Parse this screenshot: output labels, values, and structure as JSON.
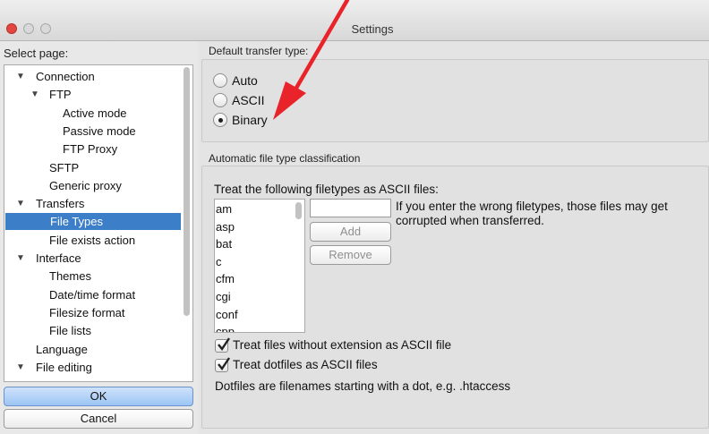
{
  "window": {
    "title": "Settings"
  },
  "left": {
    "select_page_label": "Select page:",
    "tree": [
      {
        "label": "Connection",
        "level": 0,
        "expander": true
      },
      {
        "label": "FTP",
        "level": 1,
        "expander": true
      },
      {
        "label": "Active mode",
        "level": 2,
        "expander": false
      },
      {
        "label": "Passive mode",
        "level": 2,
        "expander": false
      },
      {
        "label": "FTP Proxy",
        "level": 2,
        "expander": false
      },
      {
        "label": "SFTP",
        "level": 1,
        "expander": false
      },
      {
        "label": "Generic proxy",
        "level": 1,
        "expander": false
      },
      {
        "label": "Transfers",
        "level": 0,
        "expander": true
      },
      {
        "label": "File Types",
        "level": 1,
        "expander": false,
        "selected": true
      },
      {
        "label": "File exists action",
        "level": 1,
        "expander": false
      },
      {
        "label": "Interface",
        "level": 0,
        "expander": true
      },
      {
        "label": "Themes",
        "level": 1,
        "expander": false
      },
      {
        "label": "Date/time format",
        "level": 1,
        "expander": false
      },
      {
        "label": "Filesize format",
        "level": 1,
        "expander": false
      },
      {
        "label": "File lists",
        "level": 1,
        "expander": false
      },
      {
        "label": "Language",
        "level": 0,
        "expander": false
      },
      {
        "label": "File editing",
        "level": 0,
        "expander": true
      }
    ],
    "ok_label": "OK",
    "cancel_label": "Cancel"
  },
  "transfer_type": {
    "group_label": "Default transfer type:",
    "options": [
      {
        "label": "Auto",
        "selected": false
      },
      {
        "label": "ASCII",
        "selected": false
      },
      {
        "label": "Binary",
        "selected": true
      }
    ]
  },
  "classification": {
    "group_label": "Automatic file type classification",
    "treat_label": "Treat the following filetypes as ASCII files:",
    "filetypes": [
      "am",
      "asp",
      "bat",
      "c",
      "cfm",
      "cgi",
      "conf",
      "cpp"
    ],
    "input_value": "",
    "add_label": "Add",
    "remove_label": "Remove",
    "warning_line1": "If you enter the wrong filetypes, those files may get",
    "warning_line2": "corrupted when transferred.",
    "check_no_ext": {
      "label": "Treat files without extension as ASCII file",
      "checked": true
    },
    "check_dotfiles": {
      "label": "Treat dotfiles as ASCII files",
      "checked": true
    },
    "dotfiles_note": "Dotfiles are filenames starting with a dot, e.g. .htaccess"
  },
  "colors": {
    "selection": "#3d7ec9",
    "annotation_arrow": "#e8232a",
    "close_button": "#e2463f"
  }
}
